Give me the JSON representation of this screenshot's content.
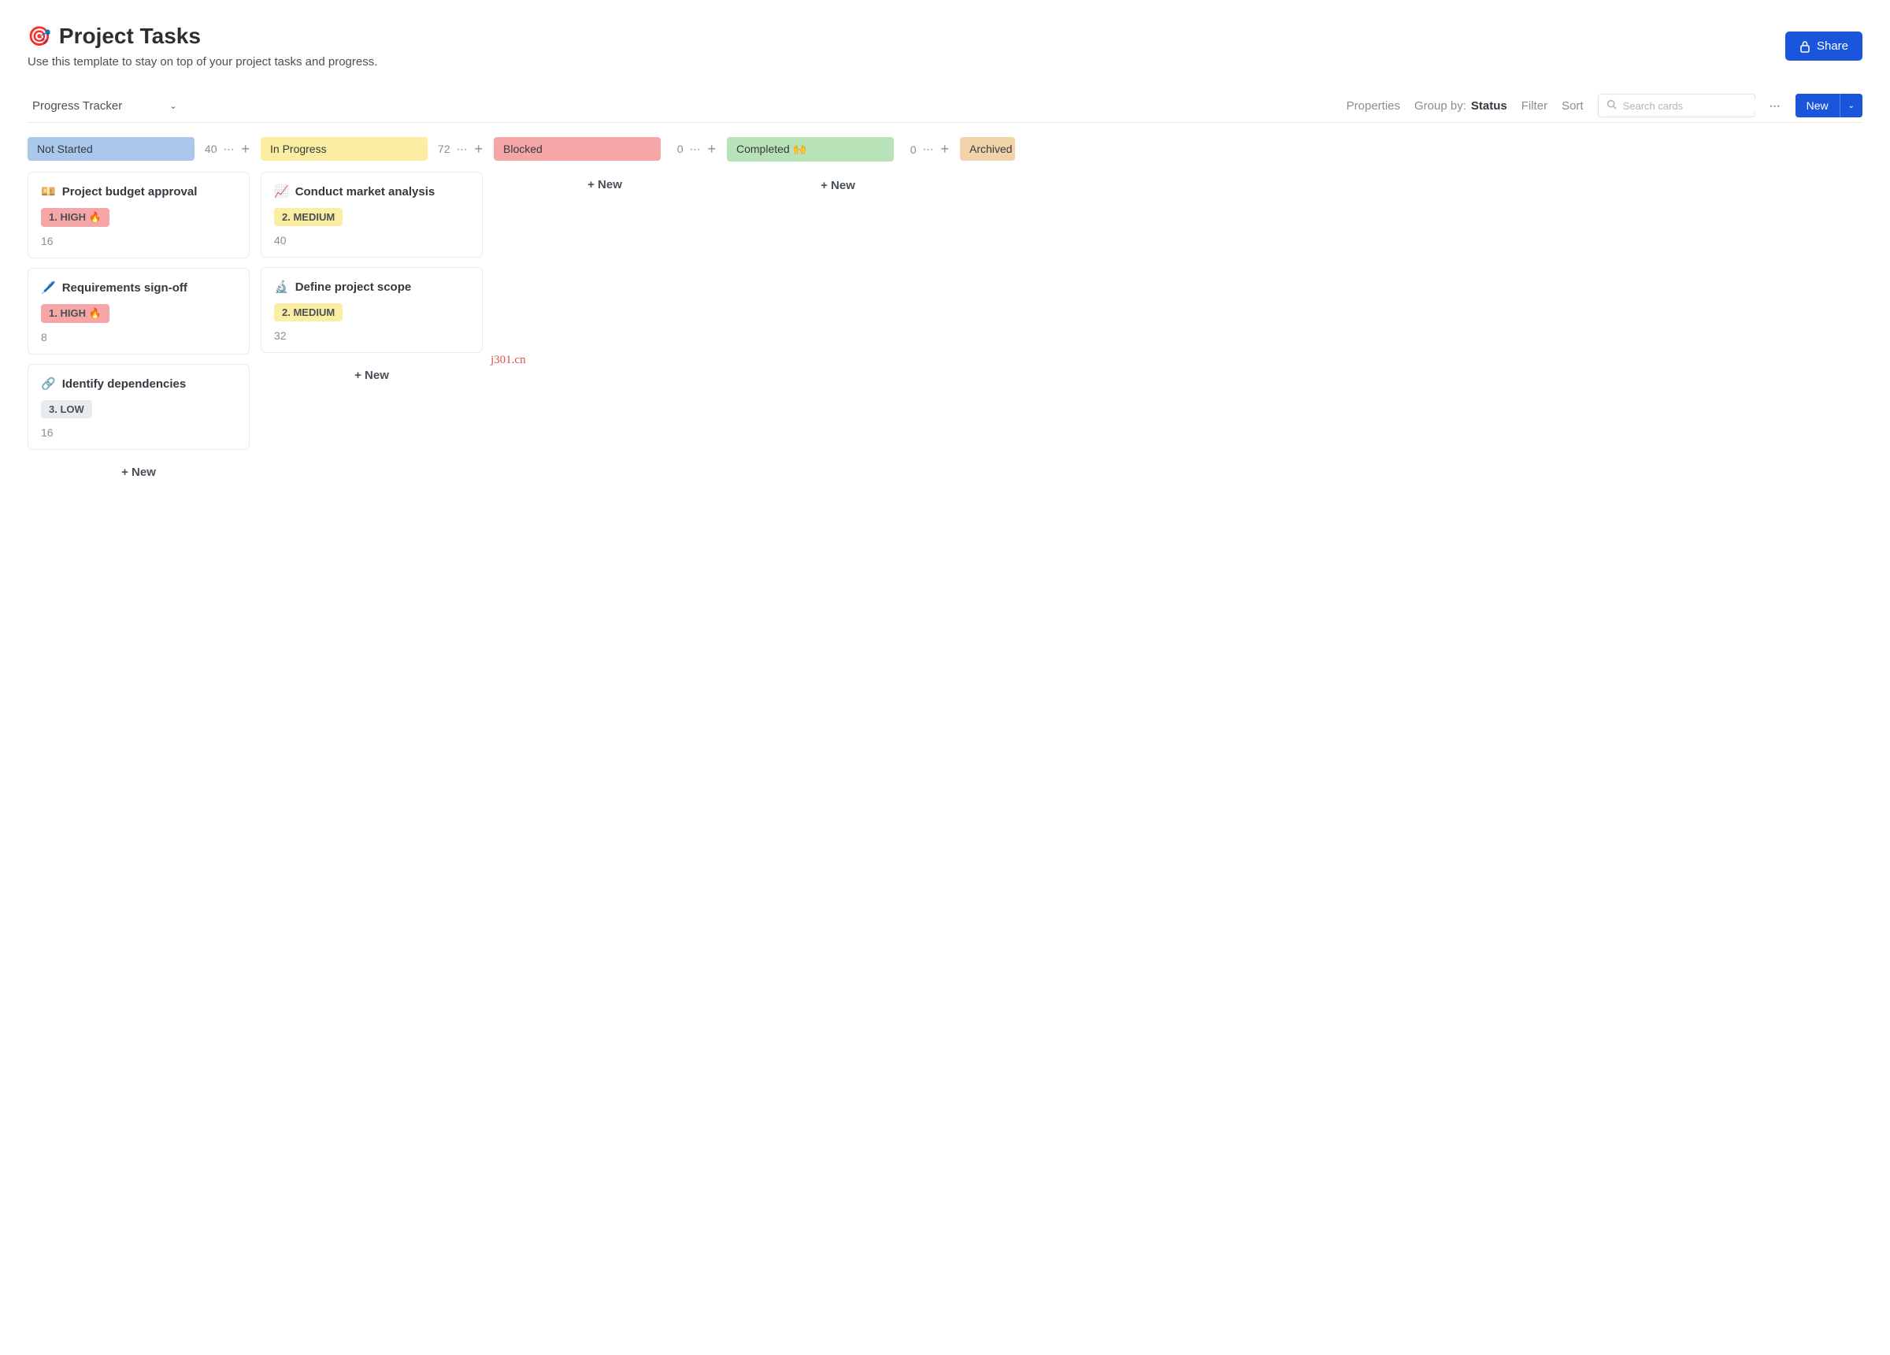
{
  "header": {
    "title_emoji": "🎯",
    "title": "Project Tasks",
    "subtitle": "Use this template to stay on top of your project tasks and progress.",
    "share_label": "Share"
  },
  "toolbar": {
    "view_name": "Progress Tracker",
    "properties_label": "Properties",
    "group_by_label": "Group by:",
    "group_by_value": "Status",
    "filter_label": "Filter",
    "sort_label": "Sort",
    "search_placeholder": "Search cards",
    "new_label": "New"
  },
  "columns": [
    {
      "name": "Not Started",
      "pill_class": "pill-notstarted",
      "count": "40",
      "cards": [
        {
          "emoji": "💴",
          "title": "Project budget approval",
          "tag": "1. HIGH 🔥",
          "tag_class": "tag-high",
          "num": "16"
        },
        {
          "emoji": "🖊️",
          "title": "Requirements sign-off",
          "tag": "1. HIGH 🔥",
          "tag_class": "tag-high",
          "num": "8"
        },
        {
          "emoji": "🔗",
          "title": "Identify dependencies",
          "tag": "3. LOW",
          "tag_class": "tag-low",
          "num": "16"
        }
      ],
      "new_label": "+ New"
    },
    {
      "name": "In Progress",
      "pill_class": "pill-inprogress",
      "count": "72",
      "cards": [
        {
          "emoji": "📈",
          "title": "Conduct market analysis",
          "tag": "2. MEDIUM",
          "tag_class": "tag-medium",
          "num": "40"
        },
        {
          "emoji": "🔬",
          "title": "Define project scope",
          "tag": "2. MEDIUM",
          "tag_class": "tag-medium",
          "num": "32"
        }
      ],
      "new_label": "+ New"
    },
    {
      "name": "Blocked",
      "pill_class": "pill-blocked",
      "count": "0",
      "cards": [],
      "new_label": "+ New"
    },
    {
      "name": "Completed 🙌",
      "pill_class": "pill-completed",
      "count": "0",
      "cards": [],
      "new_label": "+ New"
    },
    {
      "name": "Archived",
      "pill_class": "pill-archived",
      "count": "",
      "cards": [],
      "new_label": ""
    }
  ],
  "watermark": "j301.cn"
}
